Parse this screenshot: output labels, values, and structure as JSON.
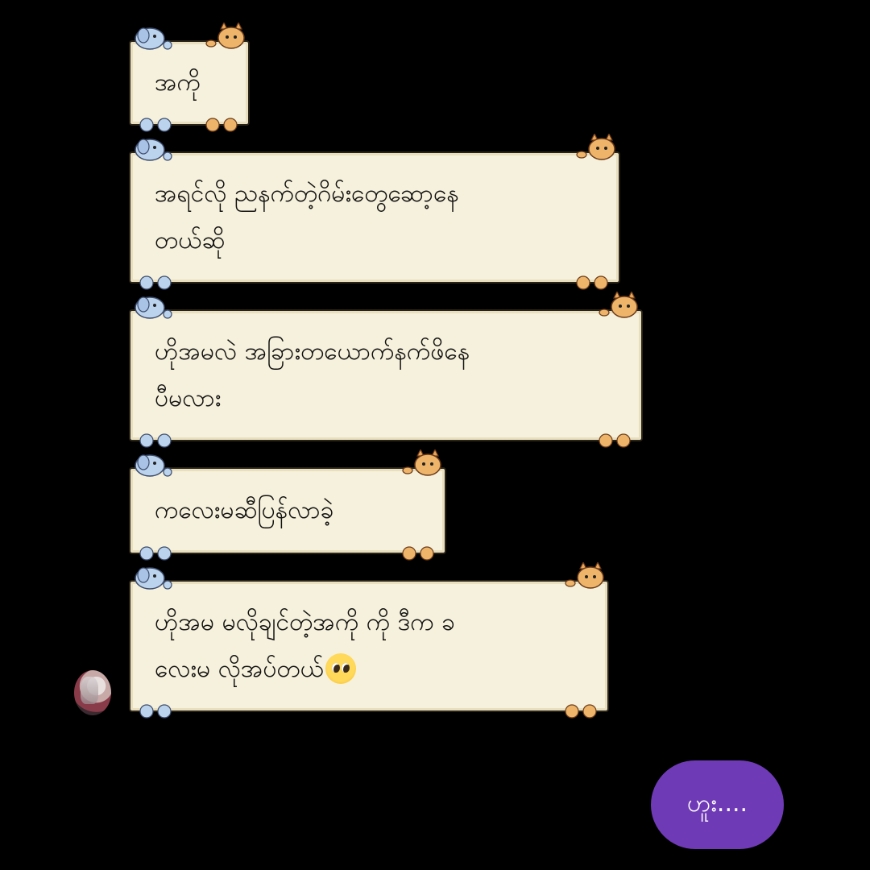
{
  "messages": [
    {
      "text": "အကို"
    },
    {
      "text": "အရင်လို ညနက်တဲ့ဂိမ်းတွေဆော့နေ\nတယ်ဆို"
    },
    {
      "text": "ဟိုအမလဲ အခြားတယောက်နက်ဖိနေ\nပီမလား"
    },
    {
      "text": "ကလေးမဆီပြန်လာခဲ့"
    },
    {
      "text": "ဟိုအမ မလိုချင်တဲ့အကို ကို ဒီက ခ\nလေးမ လိုအပ်တယ်",
      "emoji": "pleading-face-emoji"
    }
  ],
  "reply_button": {
    "label": "ဟူး...."
  },
  "colors": {
    "background": "#000000",
    "bubble": "#f6f1dc",
    "reply_button": "#6f3ab6"
  }
}
